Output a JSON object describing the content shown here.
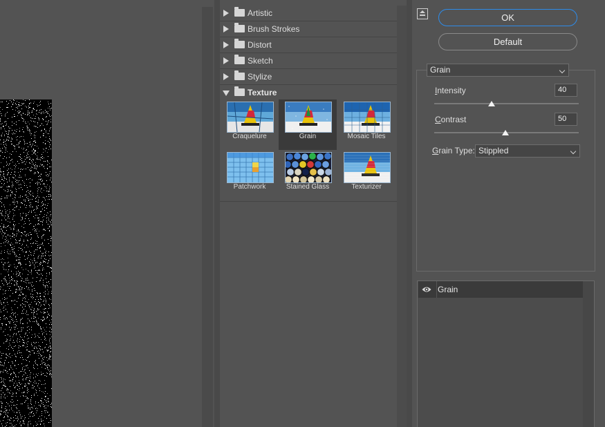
{
  "gallery": {
    "categories": [
      {
        "label": "Artistic",
        "expanded": false
      },
      {
        "label": "Brush Strokes",
        "expanded": false
      },
      {
        "label": "Distort",
        "expanded": false
      },
      {
        "label": "Sketch",
        "expanded": false
      },
      {
        "label": "Stylize",
        "expanded": false
      },
      {
        "label": "Texture",
        "expanded": true
      }
    ],
    "thumbnails": [
      {
        "label": "Craquelure",
        "selected": false
      },
      {
        "label": "Grain",
        "selected": true
      },
      {
        "label": "Mosaic Tiles",
        "selected": false
      },
      {
        "label": "Patchwork",
        "selected": false
      },
      {
        "label": "Stained Glass",
        "selected": false
      },
      {
        "label": "Texturizer",
        "selected": false
      }
    ]
  },
  "buttons": {
    "ok": "OK",
    "default": "Default"
  },
  "settings": {
    "filter_name": "Grain",
    "intensity": {
      "label_underlined": "I",
      "label_rest": "ntensity",
      "value": "40",
      "fraction": 0.4
    },
    "contrast": {
      "label_underlined": "C",
      "label_rest": "ontrast",
      "value": "50",
      "fraction": 0.5
    },
    "grain_type": {
      "label_underlined": "G",
      "label_rest": "rain Type:",
      "value": "Stippled"
    }
  },
  "layers": [
    {
      "label": "Grain",
      "visible": true
    }
  ],
  "colors": {
    "accent": "#2d8ceb",
    "panel": "#535353",
    "selected": "#3a3a3a"
  }
}
